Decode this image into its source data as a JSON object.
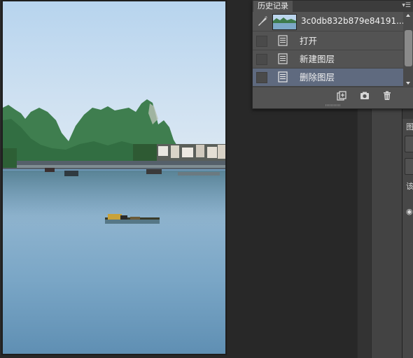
{
  "history_panel": {
    "tab_label": "历史记录",
    "snapshot_name": "3c0db832b879e84191...",
    "states": [
      {
        "label": "打开"
      },
      {
        "label": "新建图层"
      },
      {
        "label": "删除图层"
      }
    ],
    "active_index": 2
  },
  "icons": {
    "panel_menu": "panel-menu-icon",
    "brush": "history-brush-icon",
    "state": "history-state-icon",
    "new_document": "new-document-from-state-icon",
    "snapshot": "camera-icon",
    "delete": "trash-icon"
  },
  "right_dock": {
    "glyph_1": "图",
    "glyph_2": "该"
  },
  "colors": {
    "panel_bg": "#535353",
    "selected_row": "#5f6a7f",
    "workspace_bg": "#282828"
  }
}
